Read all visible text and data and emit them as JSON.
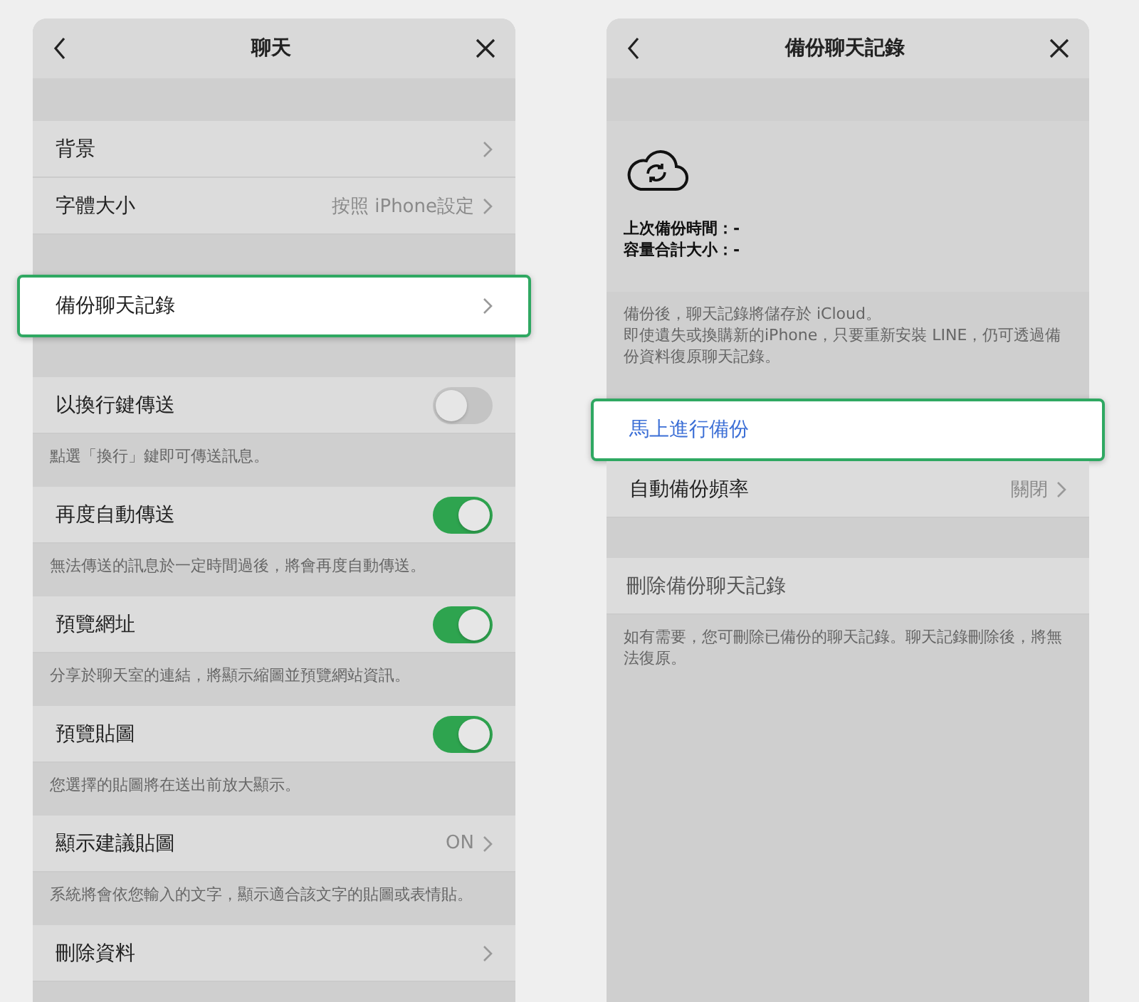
{
  "left": {
    "title": "聊天",
    "groups": [
      {
        "items": [
          {
            "kind": "nav",
            "label": "背景",
            "highlighted": false
          },
          {
            "kind": "nav",
            "label": "字體大小",
            "value": "按照 iPhone設定",
            "highlighted": false
          }
        ]
      },
      {
        "items": [
          {
            "kind": "nav",
            "label": "備份聊天記錄",
            "highlighted": true
          }
        ]
      },
      {
        "items": [
          {
            "kind": "toggle",
            "label": "以換行鍵傳送",
            "on": false,
            "highlighted": false
          }
        ],
        "note": [
          "點選「換行」鍵即可傳送訊息。"
        ]
      },
      {
        "items": [
          {
            "kind": "toggle",
            "label": "再度自動傳送",
            "on": true,
            "highlighted": false
          }
        ],
        "note": [
          "無法傳送的訊息於一定時間過後，將會再度自動傳送。"
        ]
      },
      {
        "items": [
          {
            "kind": "toggle",
            "label": "預覽網址",
            "on": true,
            "highlighted": false
          }
        ],
        "note": [
          "分享於聊天室的連結，將顯示縮圖並預覽網站資訊。"
        ]
      },
      {
        "items": [
          {
            "kind": "toggle",
            "label": "預覽貼圖",
            "on": true,
            "highlighted": false
          }
        ],
        "note": [
          "您選擇的貼圖將在送出前放大顯示。"
        ]
      },
      {
        "items": [
          {
            "kind": "nav",
            "label": "顯示建議貼圖",
            "value": "ON",
            "highlighted": false
          }
        ],
        "note": [
          "系統將會依您輸入的文字，顯示適合該文字的貼圖或表情貼。"
        ]
      },
      {
        "items": [
          {
            "kind": "nav",
            "label": "刪除資料",
            "highlighted": false
          }
        ]
      }
    ]
  },
  "right": {
    "title": "備份聊天記錄",
    "info": [
      "上次備份時間：-",
      "容量合計大小：-"
    ],
    "info_note": [
      "備份後，聊天記錄將儲存於 iCloud。",
      "即使遺失或換購新的iPhone，只要重新安裝 LINE，仍可透過備份資料復原聊天記錄。"
    ],
    "groups": [
      {
        "items": [
          {
            "kind": "link",
            "label": "馬上進行備份",
            "highlighted": true
          },
          {
            "kind": "nav",
            "label": "自動備份頻率",
            "value": "關閉",
            "highlighted": false
          }
        ]
      },
      {
        "items": [
          {
            "kind": "action",
            "label": "刪除備份聊天記錄",
            "highlighted": false
          }
        ],
        "note": [
          "如有需要，您可刪除已備份的聊天記錄。聊天記錄刪除後，將無法復原。"
        ]
      }
    ]
  }
}
